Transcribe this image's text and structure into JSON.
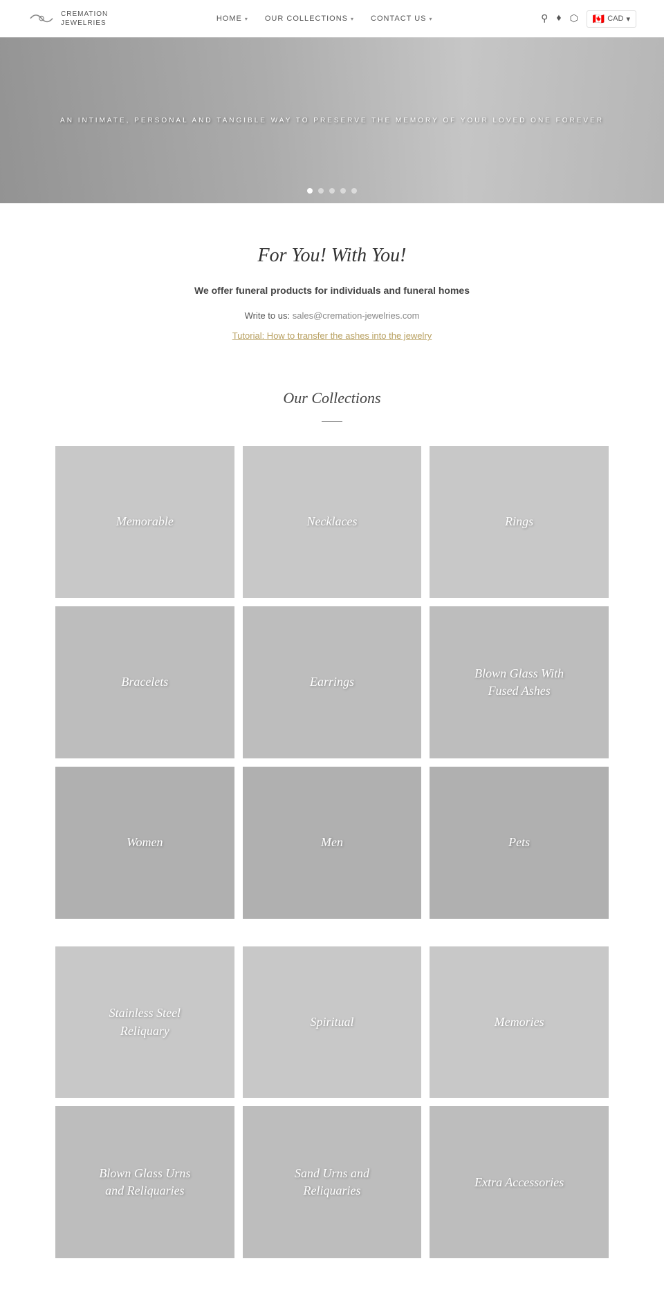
{
  "header": {
    "logo_text": "CREMATION\nJEWELRIES",
    "nav": [
      {
        "label": "HOME",
        "has_arrow": true
      },
      {
        "label": "OUR COLLECTIONS",
        "has_arrow": true
      },
      {
        "label": "CONTACT US",
        "has_arrow": true
      }
    ],
    "currency": "CAD",
    "flag_emoji": "🇨🇦"
  },
  "hero": {
    "text": "AN INTIMATE, PERSONAL AND TANGIBLE WAY TO PRESERVE THE MEMORY OF YOUR LOVED ONE FOREVER",
    "dots_count": 5,
    "active_dot": 0
  },
  "intro": {
    "title": "For You! With You!",
    "subtitle": "We offer funeral products for individuals and funeral homes",
    "email_label": "Write to us:",
    "email": "sales@cremation-jewelries.com",
    "tutorial_link": "Tutorial: How to transfer the ashes into the jewelry"
  },
  "collections": {
    "title": "Our Collections",
    "grid_rows": [
      [
        {
          "label": "Memorable"
        },
        {
          "label": "Necklaces"
        },
        {
          "label": "Rings"
        }
      ],
      [
        {
          "label": "Bracelets"
        },
        {
          "label": "Earrings"
        },
        {
          "label": "Blown Glass With\nFused Ashes"
        }
      ],
      [
        {
          "label": "Women"
        },
        {
          "label": "Men"
        },
        {
          "label": "Pets"
        }
      ]
    ],
    "grid_rows_bottom": [
      [
        {
          "label": "Stainless Steel\nReliquary"
        },
        {
          "label": "Spiritual"
        },
        {
          "label": "Memories"
        }
      ],
      [
        {
          "label": "Blown Glass Urns\nand Reliquaries"
        },
        {
          "label": "Sand Urns and\nReliquaries"
        },
        {
          "label": "Extra Accessories"
        }
      ]
    ]
  }
}
